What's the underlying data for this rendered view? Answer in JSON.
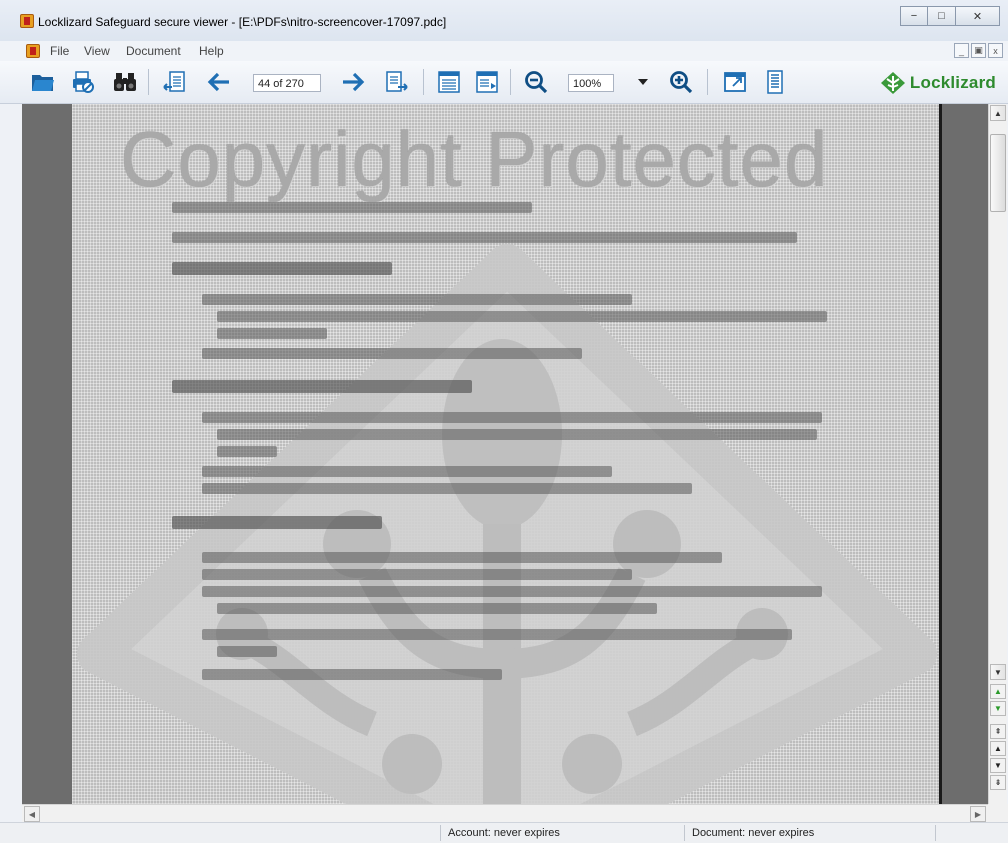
{
  "window": {
    "title": "Locklizard Safeguard secure viewer - [E:\\PDFs\\nitro-screencover-17097.pdc]",
    "controls": {
      "minimize": "−",
      "maximize": "□",
      "close": "✕"
    }
  },
  "menu": {
    "items": [
      "File",
      "View",
      "Document",
      "Help"
    ],
    "mdi_controls": [
      "_",
      "▣",
      "x"
    ]
  },
  "toolbar": {
    "page_indicator": "44 of 270",
    "zoom": "100%",
    "brand": "Locklizard",
    "icons": [
      "open-folder-icon",
      "print-disabled-icon",
      "find-binoculars-icon",
      "first-page-icon",
      "previous-page-arrow-icon",
      "next-page-arrow-icon",
      "last-page-icon",
      "page-layout-icon",
      "page-layout-alt-icon",
      "zoom-out-icon",
      "zoom-dropdown-icon",
      "zoom-in-icon",
      "fit-window-icon",
      "document-info-icon"
    ]
  },
  "document": {
    "watermark_text": "Copyright Protected"
  },
  "status": {
    "account": "Account: never expires",
    "document": "Document: never expires"
  },
  "colors": {
    "toolbar_icon_blue": "#1f6fb4",
    "brand_green": "#2e8b2e",
    "page_gray": "#bdbdbd",
    "doc_frame": "#6d6d6d"
  }
}
